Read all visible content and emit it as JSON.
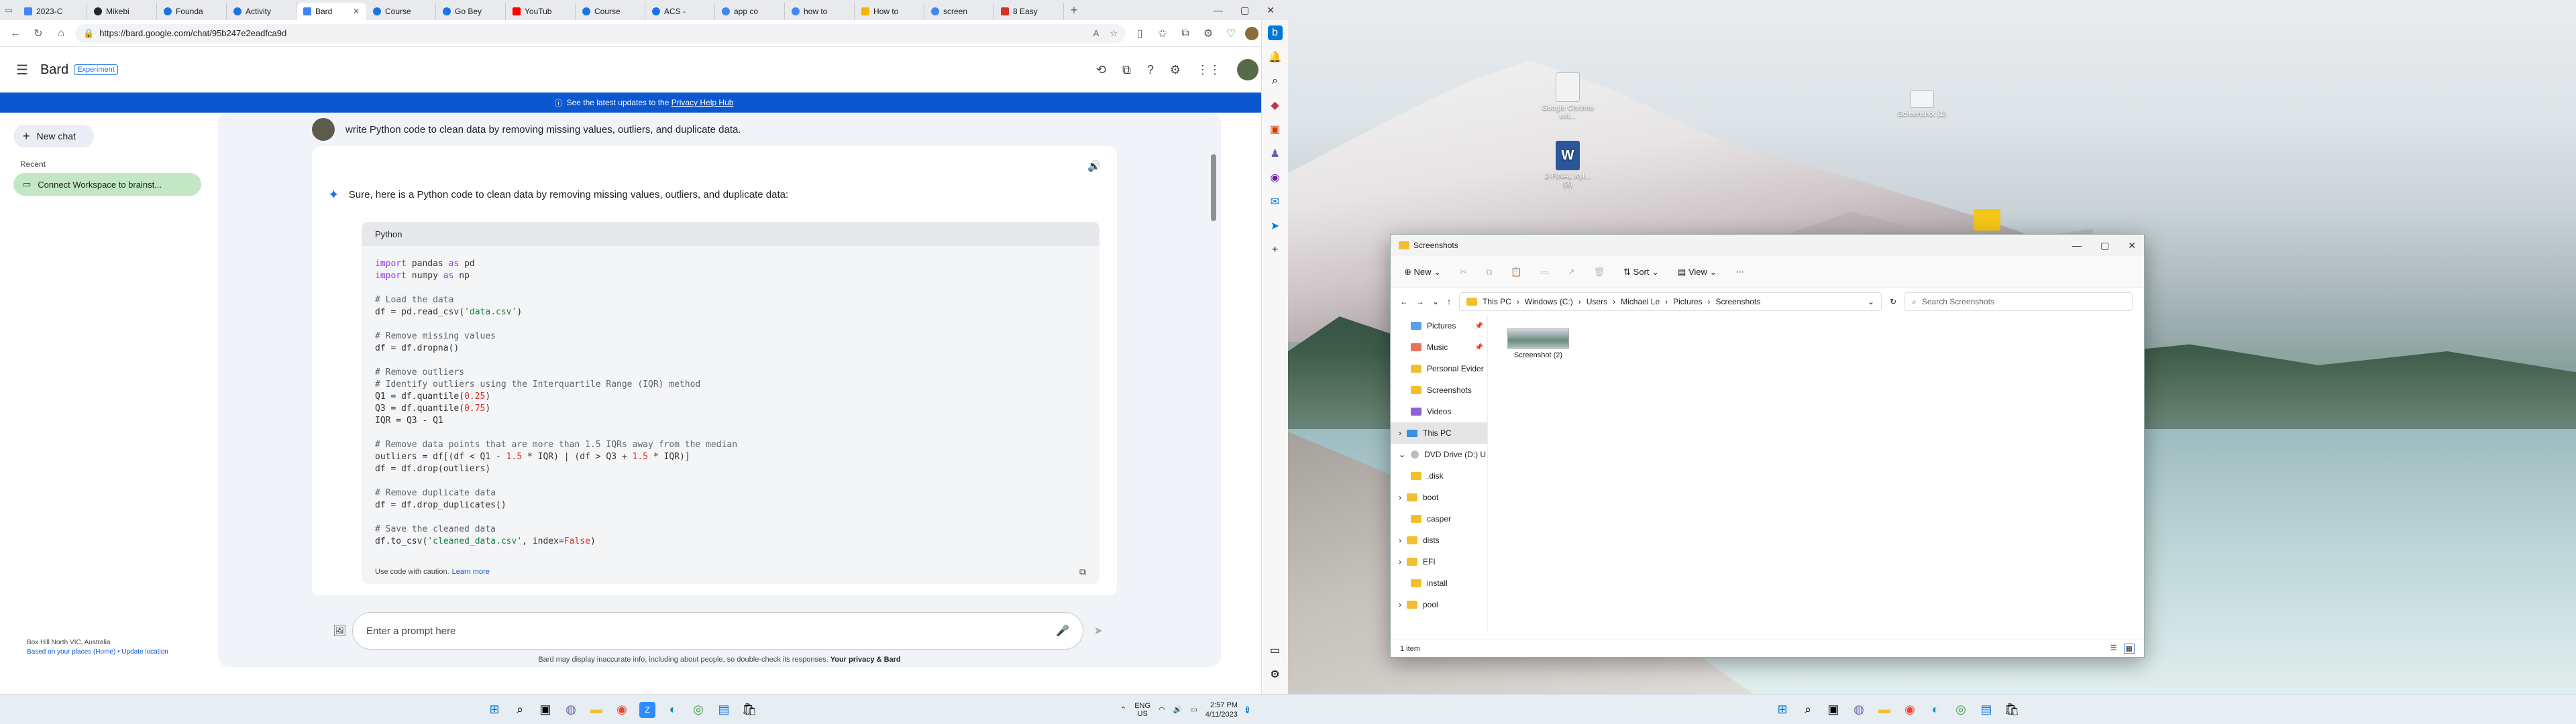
{
  "browser": {
    "tabs": [
      {
        "label": "2023-C",
        "color": "#4285f4"
      },
      {
        "label": "Mikebi",
        "color": "#24292e"
      },
      {
        "label": "Founda",
        "color": "#1a73e8"
      },
      {
        "label": "Activity",
        "color": "#1a73e8"
      },
      {
        "label": "Bard",
        "color": "#4285f4",
        "active": true
      },
      {
        "label": "Course",
        "color": "#1a73e8"
      },
      {
        "label": "Go Bey",
        "color": "#1a73e8"
      },
      {
        "label": "YouTub",
        "color": "#ff0000"
      },
      {
        "label": "Course",
        "color": "#1a73e8"
      },
      {
        "label": "ACS -",
        "color": "#1a73e8"
      },
      {
        "label": "app co",
        "color": "#4285f4"
      },
      {
        "label": "how to",
        "color": "#4285f4"
      },
      {
        "label": "How to",
        "color": "#f4b400"
      },
      {
        "label": "screen",
        "color": "#4285f4"
      },
      {
        "label": "8 Easy",
        "color": "#d93025"
      }
    ],
    "url": "https://bard.google.com/chat/95b247e2eadfca9d"
  },
  "bard": {
    "app_name": "Bard",
    "badge": "Experiment",
    "banner_text": "See the latest updates to the",
    "banner_link": "Privacy Help Hub",
    "new_chat": "New chat",
    "recent_label": "Recent",
    "recent_item": "Connect Workspace to brainst...",
    "location_line1": "Box Hill North VIC, Australia",
    "location_line2": "Based on your places (Home) • Update location",
    "user_prompt": "write Python code to clean data by removing missing values, outliers, and duplicate data.",
    "response_intro": "Sure, here is a Python code to clean data by removing missing values, outliers, and duplicate data:",
    "code_lang": "Python",
    "code_footer": "Use code with caution.",
    "code_footer_link": "Learn more",
    "prompt_placeholder": "Enter a prompt here",
    "disclaimer": "Bard may display inaccurate info, including about people, so double-check its responses.",
    "disclaimer_link": "Your privacy & Bard"
  },
  "desktop": {
    "icons": [
      {
        "label": "Google Chrome ext...",
        "type": "file"
      },
      {
        "label": "Screenshot (1)",
        "type": "file"
      },
      {
        "label": "2-FINAL Kyl... (3)",
        "type": "word"
      }
    ]
  },
  "explorer": {
    "title": "Screenshots",
    "cmd": {
      "new": "New",
      "sort": "Sort",
      "view": "View"
    },
    "breadcrumb": [
      "This PC",
      "Windows (C:)",
      "Users",
      "Michael Le",
      "Pictures",
      "Screenshots"
    ],
    "search_placeholder": "Search Screenshots",
    "nav": [
      {
        "label": "Pictures",
        "pin": true
      },
      {
        "label": "Music",
        "pin": true
      },
      {
        "label": "Personal Evider",
        "pin": false
      },
      {
        "label": "Screenshots",
        "pin": false
      },
      {
        "label": "Videos",
        "pin": false
      },
      {
        "label": "This PC",
        "sel": true
      },
      {
        "label": "DVD Drive (D:) U",
        "drive": true
      },
      {
        "label": ".disk"
      },
      {
        "label": "boot"
      },
      {
        "label": "casper"
      },
      {
        "label": "dists"
      },
      {
        "label": "EFI"
      },
      {
        "label": "install"
      },
      {
        "label": "pool"
      }
    ],
    "file": "Screenshot (2)",
    "status": "1 item"
  },
  "taskbar": {
    "lang": "ENG",
    "region": "US",
    "time": "2:57 PM",
    "date": "4/11/2023"
  }
}
